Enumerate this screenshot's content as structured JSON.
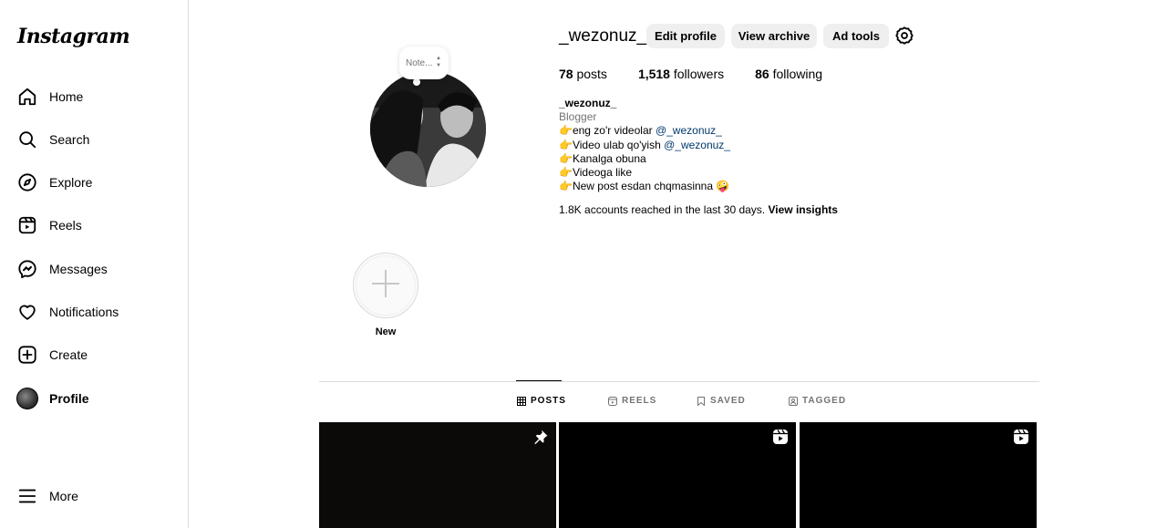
{
  "sidebar": {
    "logo": "Instagram",
    "items": [
      {
        "label": "Home",
        "icon": "home-icon"
      },
      {
        "label": "Search",
        "icon": "search-icon"
      },
      {
        "label": "Explore",
        "icon": "compass-icon"
      },
      {
        "label": "Reels",
        "icon": "reels-icon"
      },
      {
        "label": "Messages",
        "icon": "messenger-icon"
      },
      {
        "label": "Notifications",
        "icon": "heart-icon"
      },
      {
        "label": "Create",
        "icon": "plus-square-icon"
      },
      {
        "label": "Profile",
        "icon": "avatar"
      },
      {
        "label": "More",
        "icon": "hamburger-icon"
      }
    ]
  },
  "note": {
    "placeholder": "Note..."
  },
  "profile": {
    "username": "_wezonuz_",
    "buttons": {
      "edit": "Edit profile",
      "archive": "View archive",
      "ad_tools": "Ad tools"
    },
    "stats": {
      "posts_count": "78",
      "posts_label": "posts",
      "followers_count": "1,518",
      "followers_label": "followers",
      "following_count": "86",
      "following_label": "following"
    },
    "bio": {
      "name": "_wezonuz_",
      "category": "Blogger",
      "line1_text": "👉eng zo'r videolar ",
      "line1_mention": "@_wezonuz_",
      "line2_text": "👉Video ulab qo'yish ",
      "line2_mention": "@_wezonuz_",
      "line3": "👉Kanalga obuna",
      "line4": "👉Videoga like",
      "line5": "👉New post esdan chqmasinna 🤪"
    },
    "insights": {
      "text": "1.8K accounts reached in the last 30 days. ",
      "link": "View insights"
    }
  },
  "highlights": {
    "new_label": "New"
  },
  "tabs": [
    {
      "label": "POSTS",
      "icon": "grid-icon",
      "active": true
    },
    {
      "label": "REELS",
      "icon": "reels-icon",
      "active": false
    },
    {
      "label": "SAVED",
      "icon": "bookmark-icon",
      "active": false
    },
    {
      "label": "TAGGED",
      "icon": "tag-user-icon",
      "active": false
    }
  ],
  "posts": [
    {
      "badge": "pin-icon"
    },
    {
      "badge": "reel-icon"
    },
    {
      "badge": "reel-icon"
    }
  ],
  "colors": {
    "link": "#00376b",
    "secondary_text": "#737373",
    "button_bg": "#efefef",
    "border": "#dbdbdb"
  }
}
